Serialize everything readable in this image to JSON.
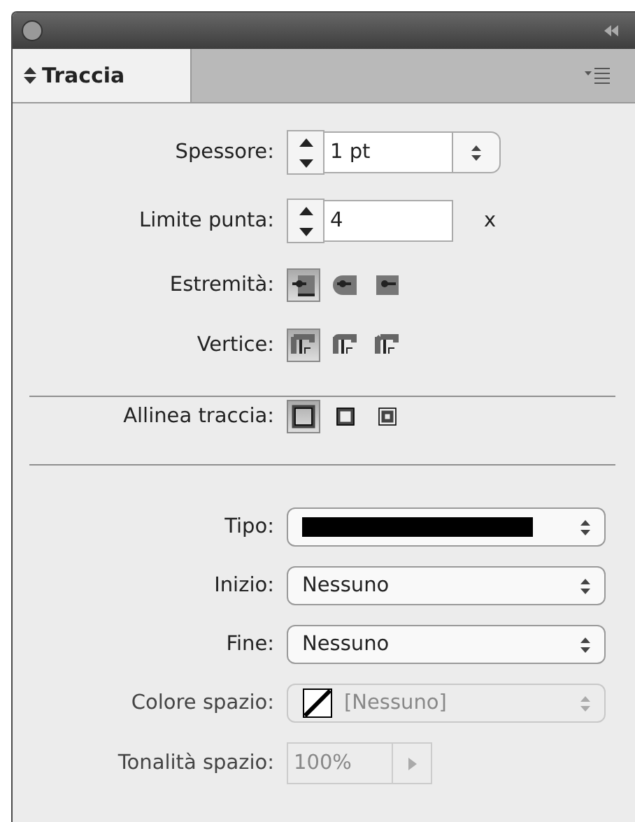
{
  "tab": {
    "label": "Traccia",
    "selected": true
  },
  "sections": [
    {
      "rows": [
        {
          "kind": "spinner",
          "label": "Spessore:",
          "value": "1 pt",
          "has_dropdown": true
        },
        {
          "kind": "spinner",
          "label": "Limite punta:",
          "value": "4",
          "suffix": "x",
          "has_dropdown": false
        },
        {
          "kind": "caps",
          "label": "Estremità:",
          "options": [
            {
              "selected": true
            },
            {
              "selected": false
            },
            {
              "selected": false
            }
          ]
        },
        {
          "kind": "joins",
          "label": "Vertice:",
          "options": [
            {
              "selected": true
            },
            {
              "selected": false
            },
            {
              "selected": false
            }
          ]
        }
      ]
    },
    {
      "rows": [
        {
          "kind": "align",
          "label": "Allinea traccia:",
          "options": [
            {
              "selected": true
            },
            {
              "selected": false
            },
            {
              "selected": false
            }
          ]
        }
      ]
    },
    {
      "rows": [
        {
          "kind": "linestyle",
          "label": "Tipo:",
          "disabled": false
        },
        {
          "kind": "select",
          "label": "Inizio:",
          "value": "Nessuno",
          "disabled": false
        },
        {
          "kind": "select",
          "label": "Fine:",
          "value": "Nessuno",
          "disabled": false
        },
        {
          "kind": "colorselect",
          "label": "Colore spazio:",
          "value": "[Nessuno]",
          "disabled": true
        },
        {
          "kind": "percent",
          "label": "Tonalità spazio:",
          "value": "100%",
          "disabled": true
        }
      ]
    }
  ]
}
